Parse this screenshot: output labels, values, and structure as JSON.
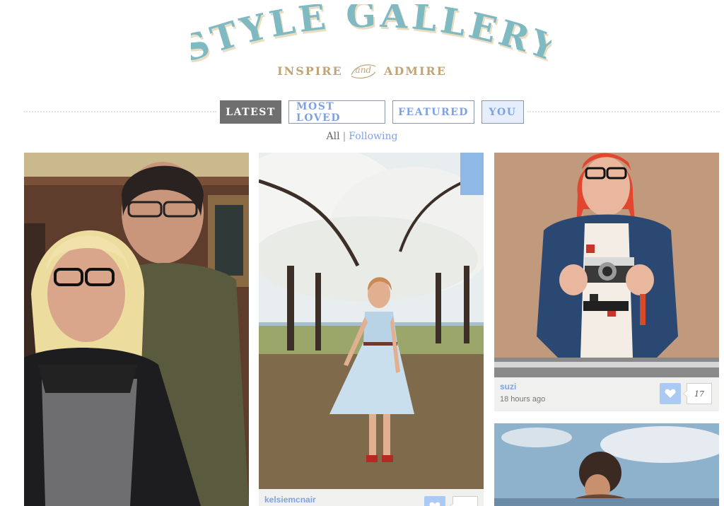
{
  "header": {
    "logo_text": "STYLE GALLERY",
    "tagline_left": "INSPIRE",
    "tagline_and": "and",
    "tagline_right": "ADMIRE"
  },
  "nav": {
    "tabs": [
      {
        "label": "LATEST",
        "active": true
      },
      {
        "label": "MOST LOVED",
        "active": false
      },
      {
        "label": "FEATURED",
        "active": false
      },
      {
        "label": "YOU",
        "active": false
      }
    ]
  },
  "filter": {
    "all_label": "All",
    "separator": "|",
    "following_label": "Following"
  },
  "posts": [
    {
      "username": "",
      "time": "",
      "loves": ""
    },
    {
      "username": "kelsiemcnair",
      "time": "",
      "loves": ""
    },
    {
      "username": "suzi",
      "time": "18 hours ago",
      "loves": "17"
    },
    {
      "username": "",
      "time": "",
      "loves": ""
    }
  ],
  "icons": {
    "heart": "heart-icon"
  },
  "colors": {
    "logo": "#7fb9c2",
    "tagline": "#c2a476",
    "link": "#7ea2e6",
    "active_tab": "#6f6f6f",
    "love_button": "#aac9f3"
  }
}
